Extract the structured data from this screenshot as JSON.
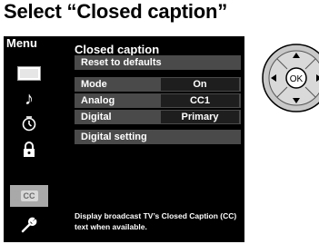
{
  "heading": "Select “Closed caption”",
  "menu": {
    "title": "Menu",
    "items": [
      {
        "icon": "picture-icon",
        "glyph": ""
      },
      {
        "icon": "music-note-icon",
        "glyph": "♪"
      },
      {
        "icon": "timer-icon",
        "glyph": ""
      },
      {
        "icon": "lock-icon",
        "glyph": ""
      },
      {
        "icon": "closed-caption-icon",
        "glyph": "CC",
        "active": true
      },
      {
        "icon": "wrench-icon",
        "glyph": ""
      }
    ]
  },
  "panel": {
    "title": "Closed caption",
    "reset_label": "Reset to defaults",
    "rows": [
      {
        "label": "Mode",
        "value": "On"
      },
      {
        "label": "Analog",
        "value": "CC1"
      },
      {
        "label": "Digital",
        "value": "Primary"
      }
    ],
    "digital_setting_label": "Digital setting",
    "description_line1": "Display broadcast TV’s Closed Caption (CC)",
    "description_line2": "text when available."
  },
  "remote": {
    "ok_label": "OK"
  },
  "colors": {
    "screen_bg": "#000000",
    "row_bg": "#4a4a4a",
    "value_bg": "#1e1e1e",
    "active_item_bg": "#a9a9a9"
  }
}
